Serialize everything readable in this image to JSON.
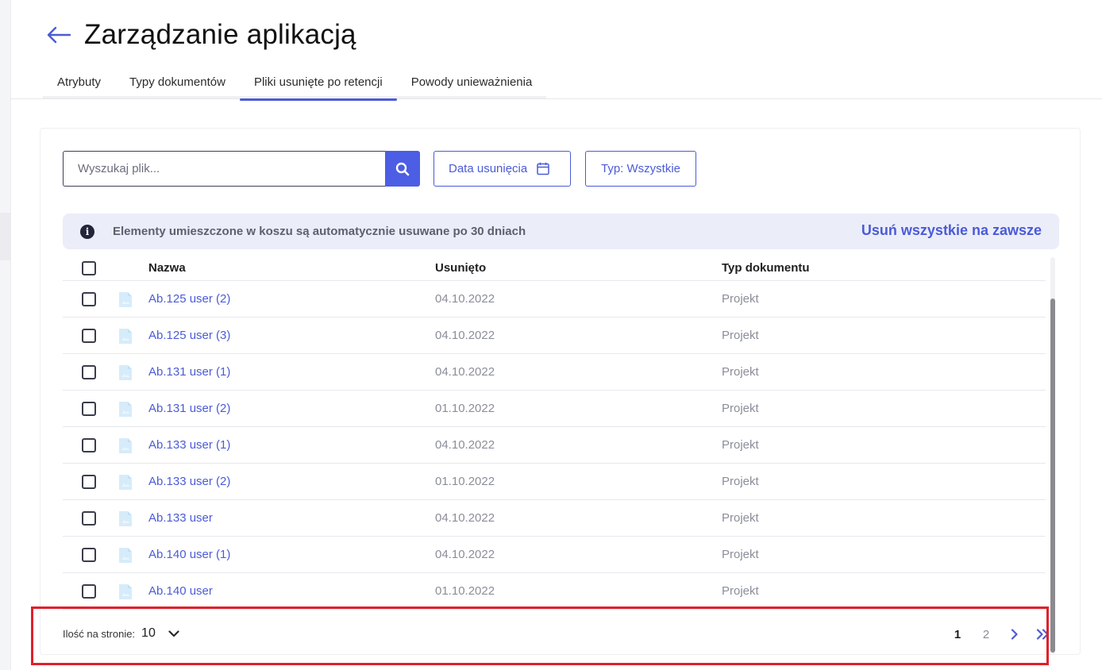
{
  "header": {
    "title": "Zarządzanie aplikacją",
    "tabs": [
      {
        "label": "Atrybuty",
        "active": false
      },
      {
        "label": "Typy dokumentów",
        "active": false
      },
      {
        "label": "Pliki usunięte po retencji",
        "active": true
      },
      {
        "label": "Powody unieważnienia",
        "active": false
      }
    ]
  },
  "toolbar": {
    "search_placeholder": "Wyszukaj plik...",
    "date_filter_label": "Data usunięcia",
    "type_filter_label": "Typ: Wszystkie"
  },
  "info": {
    "text": "Elementy umieszczone w koszu są automatycznie usuwane po 30 dniach",
    "action_label": "Usuń wszystkie na zawsze"
  },
  "table": {
    "columns": [
      "Nazwa",
      "Usunięto",
      "Typ dokumentu"
    ],
    "rows": [
      {
        "name": "Ab.125 user (2)",
        "deleted": "04.10.2022",
        "type": "Projekt"
      },
      {
        "name": "Ab.125 user (3)",
        "deleted": "04.10.2022",
        "type": "Projekt"
      },
      {
        "name": "Ab.131 user (1)",
        "deleted": "04.10.2022",
        "type": "Projekt"
      },
      {
        "name": "Ab.131 user (2)",
        "deleted": "01.10.2022",
        "type": "Projekt"
      },
      {
        "name": "Ab.133 user (1)",
        "deleted": "04.10.2022",
        "type": "Projekt"
      },
      {
        "name": "Ab.133 user (2)",
        "deleted": "01.10.2022",
        "type": "Projekt"
      },
      {
        "name": "Ab.133 user",
        "deleted": "04.10.2022",
        "type": "Projekt"
      },
      {
        "name": "Ab.140 user (1)",
        "deleted": "04.10.2022",
        "type": "Projekt"
      },
      {
        "name": "Ab.140 user",
        "deleted": "01.10.2022",
        "type": "Projekt"
      }
    ]
  },
  "pagination": {
    "per_page_label": "Ilość na stronie:",
    "per_page_value": "10",
    "pages": [
      "1",
      "2"
    ],
    "current_page": "1"
  },
  "colors": {
    "accent": "#4b5bd6",
    "highlight": "#e0202a",
    "info_bg": "#ebedf9"
  }
}
